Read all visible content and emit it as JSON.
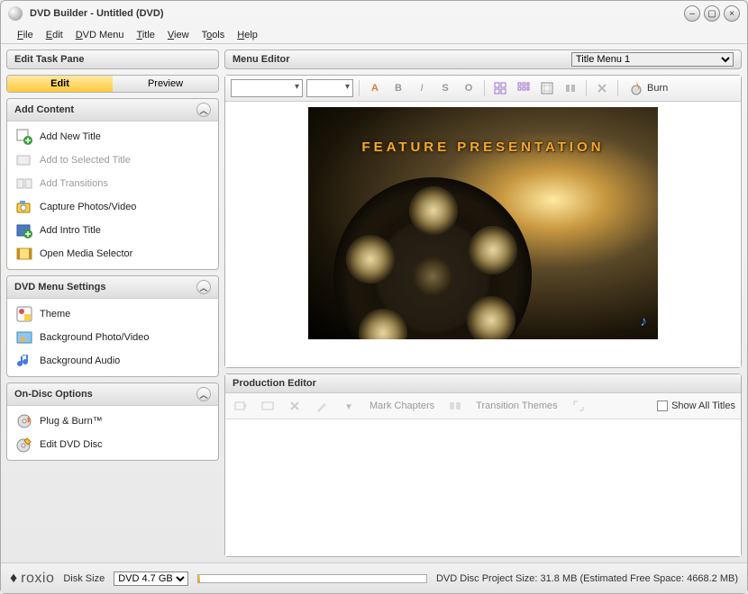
{
  "title": "DVD Builder - Untitled (DVD)",
  "menubar": [
    "File",
    "Edit",
    "DVD Menu",
    "Title",
    "View",
    "Tools",
    "Help"
  ],
  "taskPane": {
    "header": "Edit Task Pane",
    "tabs": {
      "edit": "Edit",
      "preview": "Preview"
    },
    "sections": {
      "addContent": {
        "title": "Add Content",
        "items": [
          {
            "label": "Add New Title",
            "enabled": true
          },
          {
            "label": "Add to Selected Title",
            "enabled": false
          },
          {
            "label": "Add Transitions",
            "enabled": false
          },
          {
            "label": "Capture Photos/Video",
            "enabled": true
          },
          {
            "label": "Add Intro Title",
            "enabled": true
          },
          {
            "label": "Open Media Selector",
            "enabled": true
          }
        ]
      },
      "dvdMenu": {
        "title": "DVD Menu Settings",
        "items": [
          {
            "label": "Theme"
          },
          {
            "label": "Background Photo/Video"
          },
          {
            "label": "Background Audio"
          }
        ]
      },
      "onDisc": {
        "title": "On-Disc Options",
        "items": [
          {
            "label": "Plug & Burn™"
          },
          {
            "label": "Edit DVD Disc"
          }
        ]
      }
    }
  },
  "menuEditor": {
    "header": "Menu Editor",
    "titleMenuSelected": "Title Menu 1",
    "burnLabel": "Burn",
    "featureText": "FEATURE PRESENTATION"
  },
  "productionEditor": {
    "header": "Production Editor",
    "markChapters": "Mark Chapters",
    "transitionThemes": "Transition Themes",
    "showAll": "Show All Titles"
  },
  "footer": {
    "brand": "roxio",
    "diskSizeLabel": "Disk Size",
    "diskSizeSelected": "DVD 4.7 GB",
    "projectSizeText": "DVD Disc Project Size: 31.8 MB (Estimated Free Space: 4668.2 MB)"
  }
}
